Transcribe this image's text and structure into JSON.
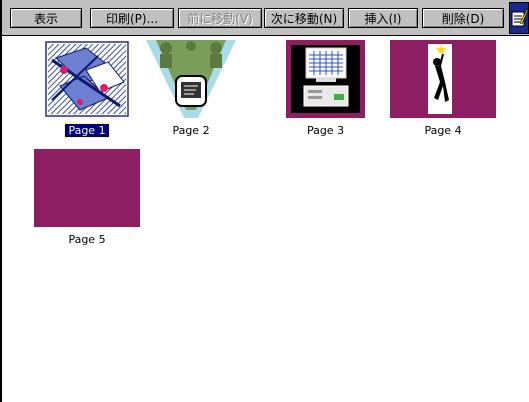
{
  "toolbar": {
    "buttons": [
      {
        "label": "表示",
        "enabled": true
      },
      {
        "label": "印刷(P)...",
        "enabled": true
      },
      {
        "label": "前に移動(V)",
        "enabled": false
      },
      {
        "label": "次に移動(N)",
        "enabled": true
      },
      {
        "label": "挿入(I)",
        "enabled": true
      },
      {
        "label": "削除(D)",
        "enabled": true
      }
    ],
    "icon": "document-pencil-icon"
  },
  "pages": [
    {
      "label": "Page 1",
      "selected": true
    },
    {
      "label": "Page 2",
      "selected": false
    },
    {
      "label": "Page 3",
      "selected": false
    },
    {
      "label": "Page 4",
      "selected": false
    },
    {
      "label": "Page 5",
      "selected": false
    }
  ],
  "colors": {
    "toolbar": "#c0c0c0",
    "slide_purple": "#8e1e62",
    "selection": "#000080"
  }
}
